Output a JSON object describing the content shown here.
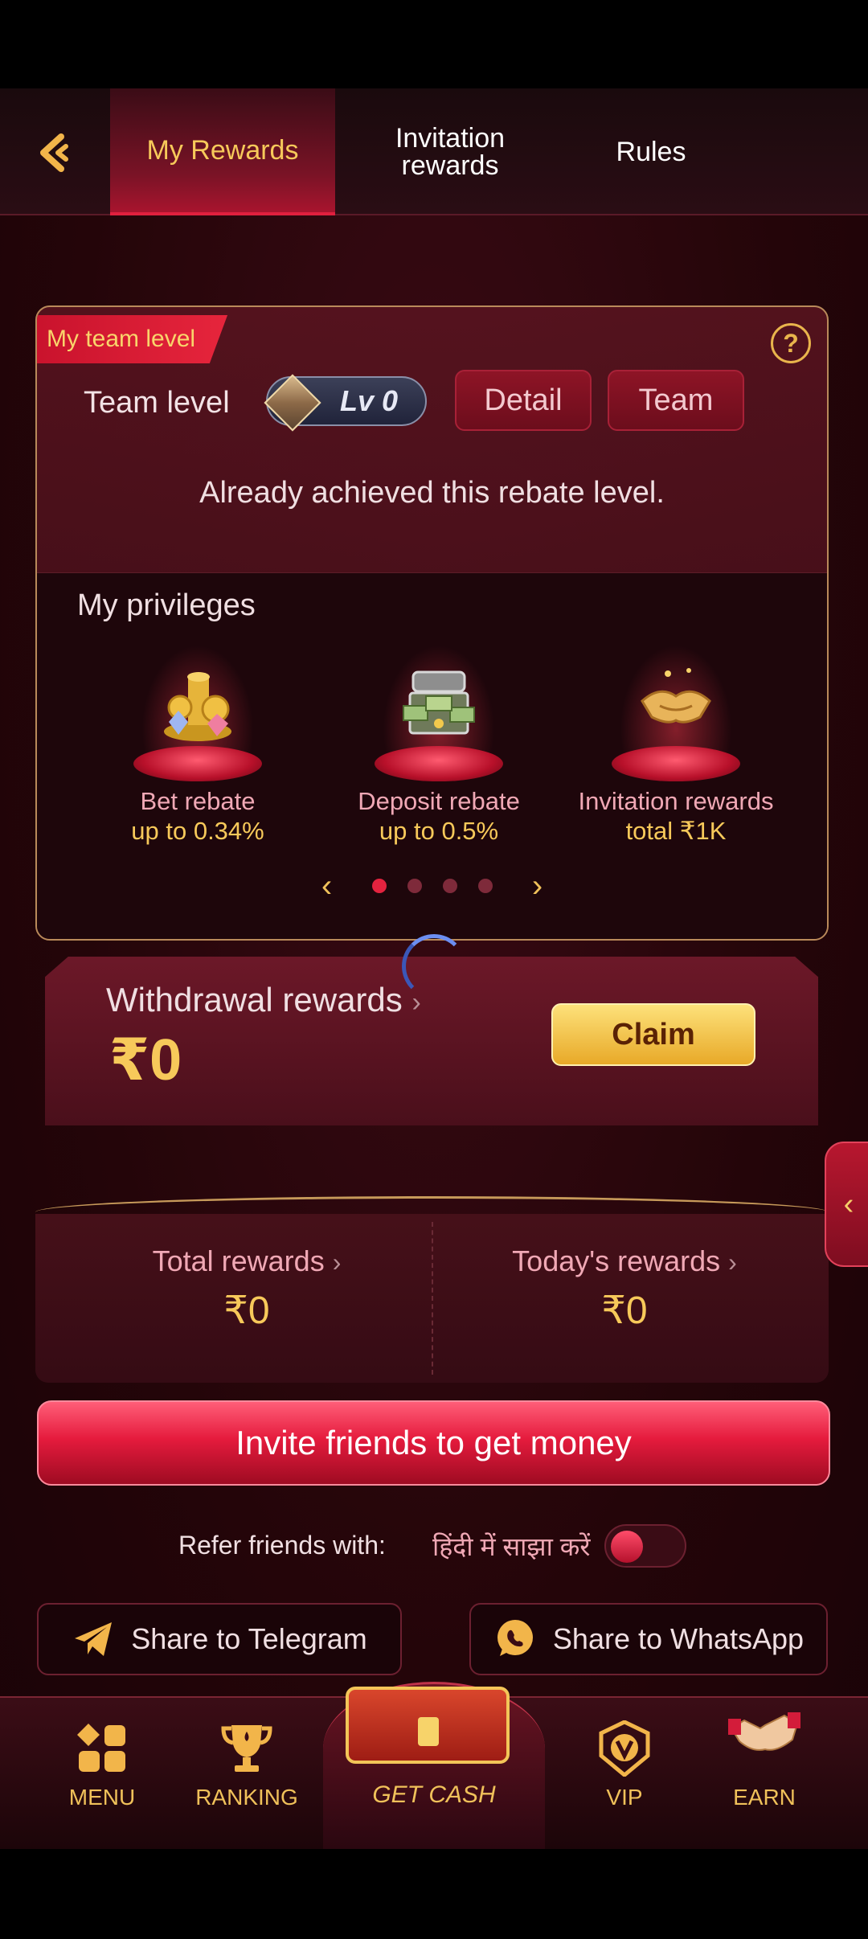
{
  "header": {
    "back_icon": "back-arrow-icon",
    "tabs": [
      {
        "label": "My Rewards",
        "active": true
      },
      {
        "label": "Invitation rewards",
        "active": false
      },
      {
        "label": "Rules",
        "active": false
      }
    ]
  },
  "team": {
    "ribbon": "My team level",
    "label": "Team level",
    "level": "Lv 0",
    "detail_button": "Detail",
    "team_button": "Team",
    "status": "Already achieved this rebate level."
  },
  "privileges": {
    "title": "My privileges",
    "items": [
      {
        "label": "Bet rebate",
        "value": "up to 0.34%",
        "icon": "coins-gems-icon"
      },
      {
        "label": "Deposit rebate",
        "value": "up to 0.5%",
        "icon": "treasure-chest-icon"
      },
      {
        "label": "Invitation rewards",
        "value": "total ₹1K",
        "icon": "handshake-icon"
      }
    ],
    "pager": {
      "pages": 4,
      "active": 1
    }
  },
  "withdrawal": {
    "title": "Withdrawal rewards",
    "amount": "₹0",
    "claim_button": "Claim"
  },
  "stats": {
    "total_label": "Total rewards",
    "total_value": "₹0",
    "today_label": "Today's rewards",
    "today_value": "₹0"
  },
  "invite_button": "Invite friends to get money",
  "refer": {
    "label": "Refer friends with:",
    "hindi": "हिंदी में साझा करें",
    "toggle_on": false
  },
  "share": {
    "telegram": "Share to Telegram",
    "whatsapp": "Share to WhatsApp"
  },
  "nav": {
    "menu": "MENU",
    "ranking": "RANKING",
    "get_cash": "GET CASH",
    "vip": "VIP",
    "earn": "EARN"
  },
  "colors": {
    "accent_gold": "#f7c95a",
    "accent_red": "#e51b3d",
    "background": "#240509"
  }
}
